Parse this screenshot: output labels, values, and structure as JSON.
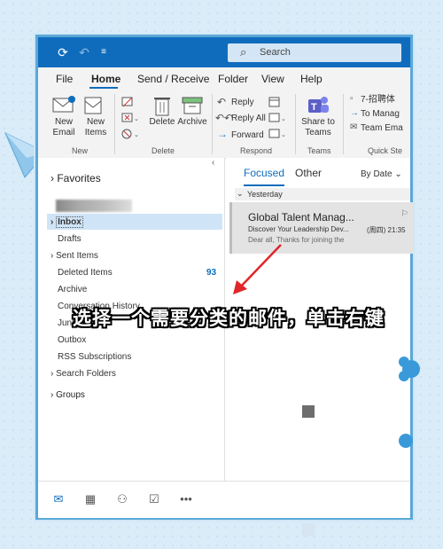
{
  "titlebar": {
    "search_label": "Search",
    "icons": [
      "sync-icon",
      "undo-icon",
      "customize-icon",
      "search-icon"
    ]
  },
  "menu": {
    "items": [
      "File",
      "Home",
      "Send / Receive",
      "Folder",
      "View",
      "Help"
    ],
    "active": "Home"
  },
  "ribbon": {
    "new_email": "New\nEmail",
    "new_items": "New\nItems",
    "new_group": "New",
    "delete": "Delete",
    "archive": "Archive",
    "delete_group": "Delete",
    "reply": "Reply",
    "reply_all": "Reply All",
    "forward": "Forward",
    "respond_group": "Respond",
    "share_to_teams": "Share to\nTeams",
    "teams_group": "Teams",
    "quick_step_1": "7-招聘体",
    "quick_step_2": "To Manag",
    "quick_step_3": "Team Ema",
    "quick_steps_group": "Quick Ste"
  },
  "sidebar": {
    "favorites": "Favorites",
    "folders": [
      {
        "label": "Inbox",
        "prefix": ">"
      },
      {
        "label": "Drafts"
      },
      {
        "label": "Sent Items",
        "prefix": ">"
      },
      {
        "label": "Deleted Items",
        "badge": "93"
      },
      {
        "label": "Archive"
      },
      {
        "label": "Conversation History"
      },
      {
        "label": "Junk"
      },
      {
        "label": "Outbox"
      },
      {
        "label": "RSS Subscriptions"
      },
      {
        "label": "Search Folders",
        "prefix": ">"
      }
    ],
    "groups": "Groups"
  },
  "message_list": {
    "tab_focused": "Focused",
    "tab_other": "Other",
    "sort_label": "By Date",
    "group_header": "Yesterday",
    "messages": [
      {
        "sender": "Global Talent Manag...",
        "subject": "Discover Your Leadership Dev...",
        "time": "(周四) 21:35",
        "preview": "Dear all,  Thanks for joining the"
      }
    ]
  },
  "caption": "选择一个需要分类的邮件，单击右键",
  "colors": {
    "accent": "#0f6cbd",
    "background": "#d9ecf8",
    "arrow": "#e0262a"
  }
}
